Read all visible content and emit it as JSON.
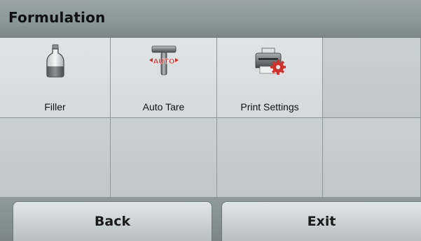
{
  "header": {
    "title": "Formulation"
  },
  "menu": {
    "items": [
      {
        "label": "Filler",
        "icon": "bottle-icon"
      },
      {
        "label": "Auto Tare",
        "icon": "auto-tare-icon",
        "icon_text": "AUTO"
      },
      {
        "label": "Print Settings",
        "icon": "printer-settings-icon"
      }
    ]
  },
  "footer": {
    "back_label": "Back",
    "exit_label": "Exit"
  },
  "colors": {
    "accent_red": "#d0302a",
    "header_gray": "#8c9798"
  }
}
